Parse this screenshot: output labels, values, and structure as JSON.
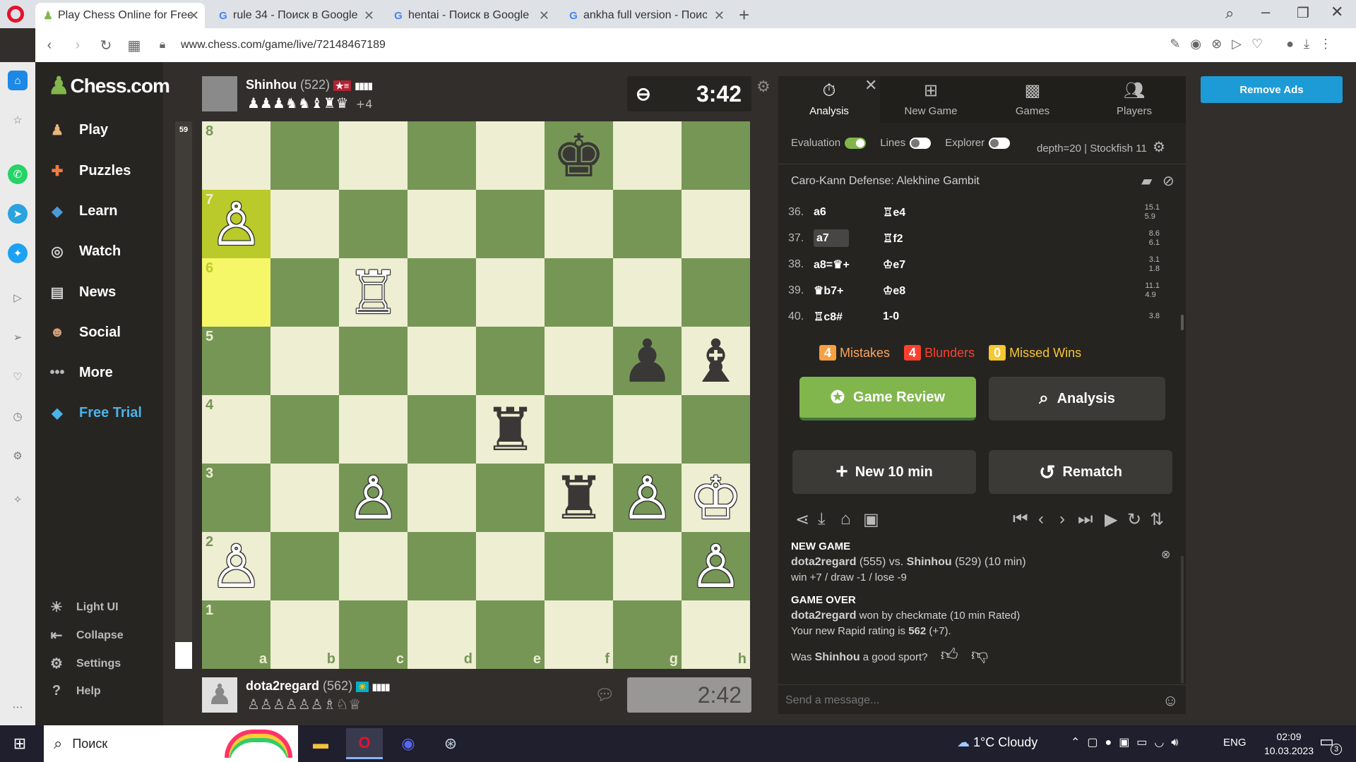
{
  "browser": {
    "tabs": [
      {
        "title": "Play Chess Online for Free",
        "icon": "chess-pawn-icon"
      },
      {
        "title": "rule 34 - Поиск в Google",
        "icon": "google-icon"
      },
      {
        "title": "hentai - Поиск в Google",
        "icon": "google-icon"
      },
      {
        "title": "ankha full version - Поиск",
        "icon": "google-icon"
      }
    ],
    "url": "www.chess.com/game/live/72148467189"
  },
  "leftnav": {
    "logo": "Chess.com",
    "items": [
      {
        "label": "Play",
        "icon": "play-pawn-icon"
      },
      {
        "label": "Puzzles",
        "icon": "puzzle-icon"
      },
      {
        "label": "Learn",
        "icon": "learn-cap-icon"
      },
      {
        "label": "Watch",
        "icon": "binoculars-icon"
      },
      {
        "label": "News",
        "icon": "news-icon"
      },
      {
        "label": "Social",
        "icon": "social-icon"
      },
      {
        "label": "More",
        "icon": "more-dots-icon"
      },
      {
        "label": "Free Trial",
        "icon": "diamond-icon"
      }
    ],
    "bottom": [
      {
        "label": "Light UI",
        "icon": "sun-icon"
      },
      {
        "label": "Collapse",
        "icon": "collapse-icon"
      },
      {
        "label": "Settings",
        "icon": "gear-icon"
      },
      {
        "label": "Help",
        "icon": "help-icon"
      }
    ]
  },
  "eval_bar": {
    "value": "59"
  },
  "top_player": {
    "name": "Shinhou",
    "rating": "(522)",
    "captured": "♟♟♟♞♞♝♜♛",
    "material": "+4",
    "clock": "3:42"
  },
  "bottom_player": {
    "name": "dota2regard",
    "rating": "(562)",
    "captured": "♙♙♙♙♙♙♗♘♕",
    "clock": "2:42"
  },
  "board": {
    "ranks": [
      "8",
      "7",
      "6",
      "5",
      "4",
      "3",
      "2",
      "1"
    ],
    "files": [
      "a",
      "b",
      "c",
      "d",
      "e",
      "f",
      "g",
      "h"
    ],
    "rows": [
      [
        "",
        "",
        "",
        "",
        "",
        "♚",
        "",
        ""
      ],
      [
        "♙",
        "",
        "",
        "",
        "",
        "",
        "",
        ""
      ],
      [
        "",
        "",
        "♖",
        "",
        "",
        "",
        "",
        ""
      ],
      [
        "",
        "",
        "",
        "",
        "",
        "",
        "♟",
        "♝"
      ],
      [
        "",
        "",
        "",
        "",
        "♜",
        "",
        "",
        ""
      ],
      [
        "",
        "",
        "♙",
        "",
        "",
        "♜",
        "♙",
        "♔"
      ],
      [
        "♙",
        "",
        "",
        "",
        "",
        "",
        "",
        "♙"
      ],
      [
        "",
        "",
        "",
        "",
        "",
        "",
        "",
        ""
      ]
    ],
    "colors": [
      [
        "",
        "",
        "",
        "",
        "",
        "b",
        "",
        ""
      ],
      [
        "w",
        "",
        "",
        "",
        "",
        "",
        "",
        ""
      ],
      [
        "",
        "",
        "w",
        "",
        "",
        "",
        "",
        ""
      ],
      [
        "",
        "",
        "",
        "",
        "",
        "",
        "b",
        "b"
      ],
      [
        "",
        "",
        "",
        "",
        "b",
        "",
        "",
        ""
      ],
      [
        "",
        "",
        "w",
        "",
        "",
        "b",
        "w",
        "w"
      ],
      [
        "w",
        "",
        "",
        "",
        "",
        "",
        "",
        "w"
      ],
      [
        "",
        "",
        "",
        "",
        "",
        "",
        "",
        ""
      ]
    ]
  },
  "panel": {
    "tabs": [
      {
        "label": "Analysis",
        "icon": "stopwatch-icon"
      },
      {
        "label": "New Game",
        "icon": "plus-square-icon"
      },
      {
        "label": "Games",
        "icon": "checker-icon"
      },
      {
        "label": "Players",
        "icon": "players-icon"
      }
    ],
    "toggles": {
      "evaluation": "Evaluation",
      "lines": "Lines",
      "explorer": "Explorer"
    },
    "engine": "depth=20 |  Stockfish 11",
    "opening": "Caro-Kann Defense: Alekhine Gambit",
    "moves": [
      {
        "n": "36.",
        "w": "a6",
        "b": "♖e4",
        "e1": "15.1",
        "e2": "5.9"
      },
      {
        "n": "37.",
        "w": "a7",
        "b": "♖f2",
        "e1": "8.6",
        "e2": "6.1"
      },
      {
        "n": "38.",
        "w": "a8=♛+",
        "b": "♔e7",
        "e1": "3.1",
        "e2": "1.8"
      },
      {
        "n": "39.",
        "w": "♛b7+",
        "b": "♔e8",
        "e1": "11.1",
        "e2": "4.9"
      },
      {
        "n": "40.",
        "w": "♖c8#",
        "b": "1-0",
        "e1": "3.8",
        "e2": ""
      }
    ],
    "stats": {
      "mistakes_count": "4",
      "mistakes": "Mistakes",
      "blunders_count": "4",
      "blunders": "Blunders",
      "missed_count": "0",
      "missed": "Missed Wins"
    },
    "buttons": {
      "review": "Game Review",
      "analysis": "Analysis",
      "new10": "New 10 min",
      "rematch": "Rematch"
    },
    "chat": {
      "new_game_header": "NEW GAME",
      "ng_white": "dota2regard",
      "ng_white_rating": "(555)",
      "vs": "vs.",
      "ng_black": "Shinhou",
      "ng_black_rating": "(529)",
      "ng_time": "(10 min)",
      "record": "win +7 / draw -1 / lose -9",
      "over_header": "GAME OVER",
      "winner": "dota2regard",
      "result_text": "won by checkmate (10 min Rated)",
      "rating_text": "Your new Rapid rating is",
      "rating_val": "562",
      "rating_delta": "(+7).",
      "sport_q1": "Was",
      "sport_name": "Shinhou",
      "sport_q2": "a good sport?",
      "placeholder": "Send a message..."
    }
  },
  "remove_ads": "Remove Ads",
  "taskbar": {
    "search": "Поиск",
    "weather": "1°C  Cloudy",
    "lang": "ENG",
    "time": "02:09",
    "date": "10.03.2023",
    "notif": "3"
  }
}
